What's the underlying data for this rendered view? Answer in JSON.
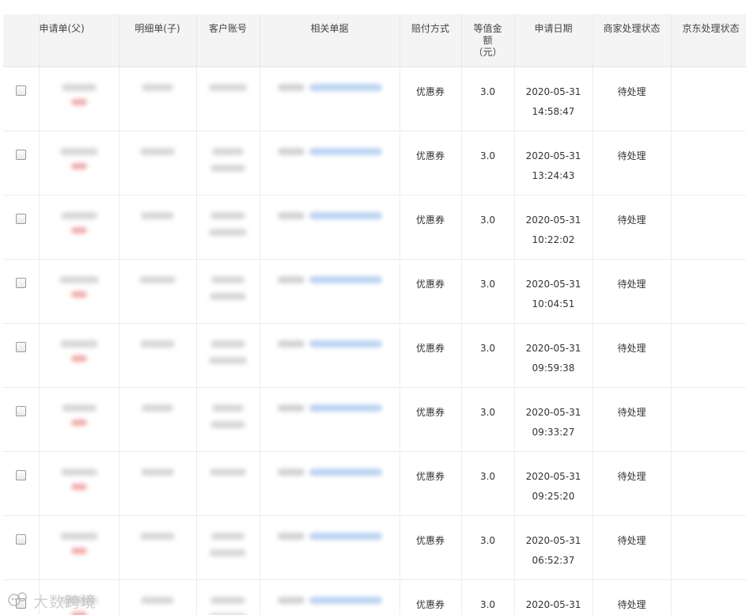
{
  "table": {
    "headers": {
      "parent": "申请单(父)",
      "child": "明细单(子)",
      "account": "客户账号",
      "docs": "相关单据",
      "pay_method": "赔付方式",
      "amount_lines": [
        "等值金",
        "额",
        "（元）"
      ],
      "apply_date": "申请日期",
      "merchant_status": "商家处理状态",
      "jd_status": "京东处理状态"
    },
    "rows": [
      {
        "pay_method": "优惠券",
        "amount": "3.0",
        "date": "2020-05-31",
        "time": "14:58:47",
        "merchant_status": "待处理",
        "jd_status": ""
      },
      {
        "pay_method": "优惠券",
        "amount": "3.0",
        "date": "2020-05-31",
        "time": "13:24:43",
        "merchant_status": "待处理",
        "jd_status": ""
      },
      {
        "pay_method": "优惠券",
        "amount": "3.0",
        "date": "2020-05-31",
        "time": "10:22:02",
        "merchant_status": "待处理",
        "jd_status": ""
      },
      {
        "pay_method": "优惠券",
        "amount": "3.0",
        "date": "2020-05-31",
        "time": "10:04:51",
        "merchant_status": "待处理",
        "jd_status": ""
      },
      {
        "pay_method": "优惠券",
        "amount": "3.0",
        "date": "2020-05-31",
        "time": "09:59:38",
        "merchant_status": "待处理",
        "jd_status": ""
      },
      {
        "pay_method": "优惠券",
        "amount": "3.0",
        "date": "2020-05-31",
        "time": "09:33:27",
        "merchant_status": "待处理",
        "jd_status": ""
      },
      {
        "pay_method": "优惠券",
        "amount": "3.0",
        "date": "2020-05-31",
        "time": "09:25:20",
        "merchant_status": "待处理",
        "jd_status": ""
      },
      {
        "pay_method": "优惠券",
        "amount": "3.0",
        "date": "2020-05-31",
        "time": "06:52:37",
        "merchant_status": "待处理",
        "jd_status": ""
      },
      {
        "pay_method": "优惠券",
        "amount": "3.0",
        "date": "2020-05-31",
        "time": "",
        "merchant_status": "待处理",
        "jd_status": ""
      }
    ]
  },
  "watermark": {
    "text": "大数跨境",
    "icon": "sea-otter-logo-icon"
  },
  "colors": {
    "header_bg": "#f4f4f4",
    "border": "#ececec",
    "link_blue": "#b9d3f2",
    "red_tag": "#f5a8a8"
  }
}
